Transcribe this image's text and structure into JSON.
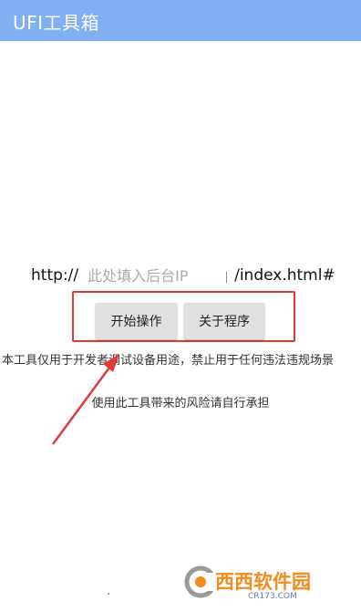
{
  "app_bar": {
    "title": "UFI工具箱",
    "color": "#7fb0f4"
  },
  "url_row": {
    "prefix": "http://",
    "ip_placeholder": "此处填入后台IP",
    "ip_value": "",
    "suffix": "/index.html#"
  },
  "buttons": {
    "start_label": "开始操作",
    "about_label": "关于程序"
  },
  "notice_text": "本工具仅用于开发者调试设备用途，禁止用于任何违法违规场景",
  "risk_text": "使用此工具带来的风险请自行承担",
  "annotation": {
    "highlight_color": "#e23a3a"
  },
  "watermark": {
    "text": "西西软件园",
    "sub": "CR173.COM"
  }
}
